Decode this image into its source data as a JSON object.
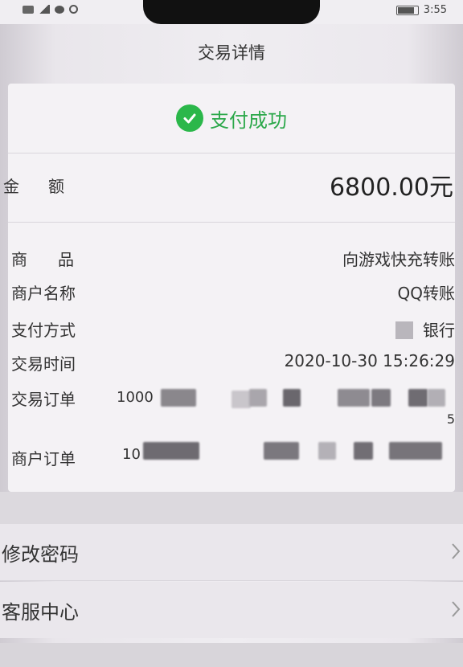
{
  "status_bar": {
    "time": "3:55",
    "left_icons": [
      "hd-icon",
      "signal-icon",
      "message-icon",
      "location-icon"
    ],
    "battery_icon": "battery-icon"
  },
  "header": {
    "title": "交易详情"
  },
  "payment": {
    "status_icon": "check-circle-icon",
    "status_text": "支付成功",
    "status_color": "#2bb74a",
    "amount_label": "金额",
    "amount_value": "6800.00元"
  },
  "details": [
    {
      "label": "商品",
      "value": "向游戏快充转账"
    },
    {
      "label": "商户名称",
      "value": "QQ转账"
    },
    {
      "label": "支付方式",
      "value": "银行"
    },
    {
      "label": "交易时间",
      "value": "2020-10-30 15:26:29"
    },
    {
      "label": "交易订单",
      "value_prefix": "1000",
      "value_suffix": "5"
    },
    {
      "label": "商户订单",
      "value_prefix": "10"
    }
  ],
  "menu": [
    {
      "label": "修改密码",
      "icon": "chevron-right-icon"
    },
    {
      "label": "客服中心",
      "icon": "chevron-right-icon"
    }
  ]
}
